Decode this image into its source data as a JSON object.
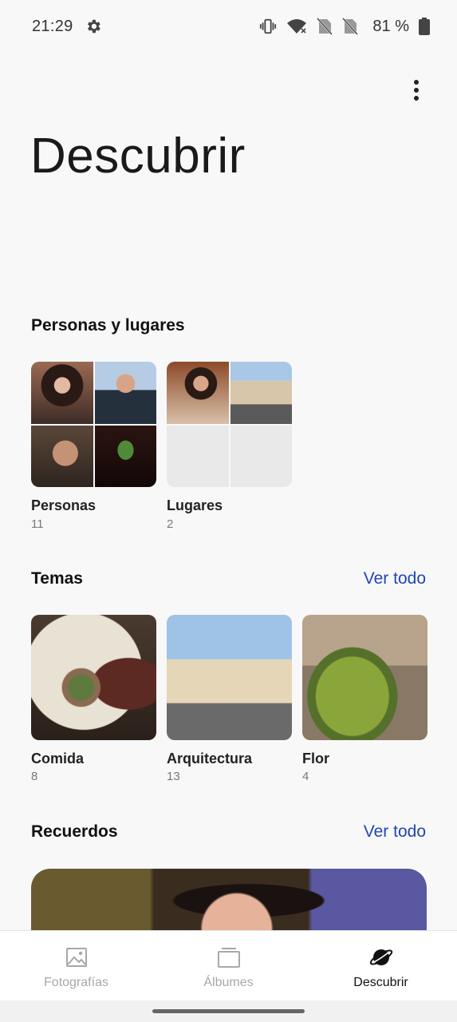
{
  "status_bar": {
    "time": "21:29",
    "battery": "81 %",
    "icons": [
      "gear-icon",
      "vibrate-icon",
      "wifi-icon",
      "no-sim-icon",
      "no-sim-icon",
      "battery-icon"
    ]
  },
  "header": {
    "title": "Descubrir",
    "menu_icon": "more-vert-icon"
  },
  "people_places": {
    "title": "Personas y lugares",
    "items": [
      {
        "label": "Personas",
        "count": "11"
      },
      {
        "label": "Lugares",
        "count": "2"
      }
    ]
  },
  "themes": {
    "title": "Temas",
    "see_all": "Ver todo",
    "items": [
      {
        "label": "Comida",
        "count": "8"
      },
      {
        "label": "Arquitectura",
        "count": "13"
      },
      {
        "label": "Flor",
        "count": "4"
      }
    ]
  },
  "memories": {
    "title": "Recuerdos",
    "see_all": "Ver todo"
  },
  "bottom_nav": {
    "items": [
      {
        "label": "Fotografías",
        "icon": "photo-icon",
        "active": false
      },
      {
        "label": "Álbumes",
        "icon": "albums-icon",
        "active": false
      },
      {
        "label": "Descubrir",
        "icon": "planet-icon",
        "active": true
      }
    ]
  },
  "colors": {
    "accent": "#2145b5",
    "background": "#f8f8f8",
    "nav_inactive": "#a8a8a8"
  }
}
